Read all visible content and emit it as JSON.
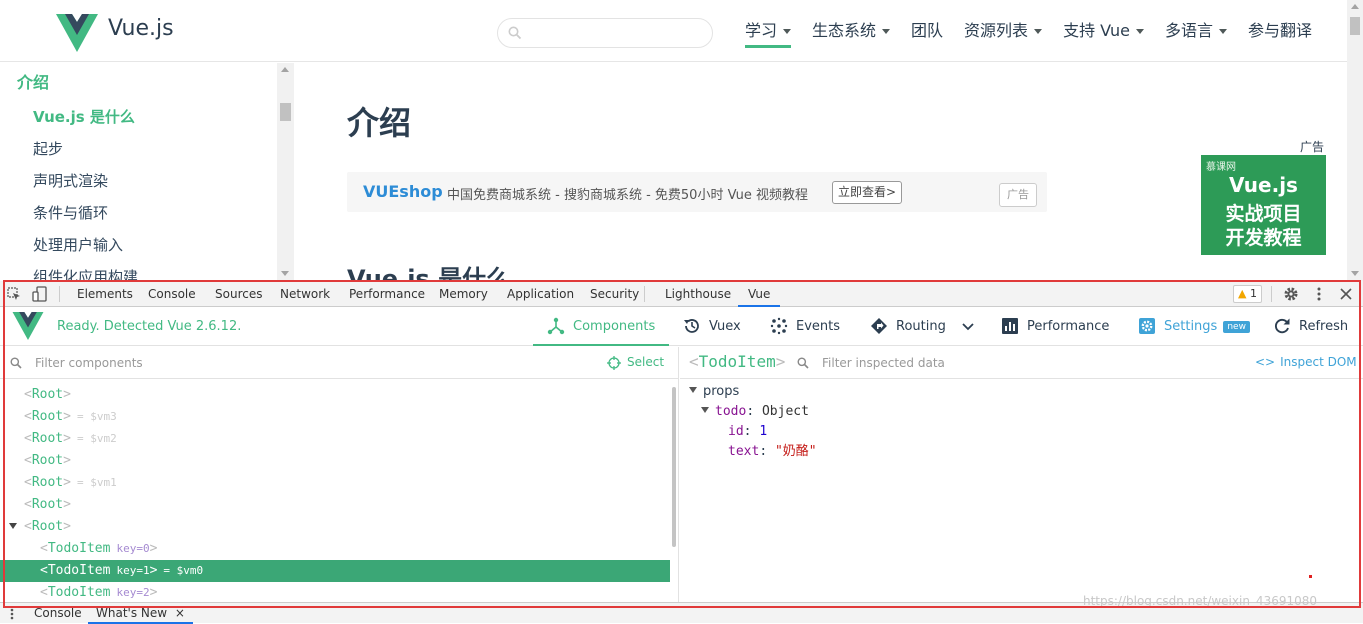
{
  "site": {
    "brand": "Vue.js",
    "nav": [
      {
        "label": "学习",
        "dropdown": true,
        "active": true
      },
      {
        "label": "生态系统",
        "dropdown": true
      },
      {
        "label": "团队",
        "dropdown": false
      },
      {
        "label": "资源列表",
        "dropdown": true
      },
      {
        "label": "支持 Vue",
        "dropdown": true
      },
      {
        "label": "多语言",
        "dropdown": true
      },
      {
        "label": "参与翻译",
        "dropdown": false
      }
    ],
    "sidebar": {
      "title": "介绍",
      "items": [
        "Vue.js 是什么",
        "起步",
        "声明式渲染",
        "条件与循环",
        "处理用户输入",
        "组件化应用构建"
      ]
    },
    "content": {
      "title": "介绍",
      "ad": {
        "brand": "VUEshop",
        "text": "中国免费商城系统 - 搜豹商城系统 - 免费50小时 Vue 视频教程",
        "cta": "立即查看>",
        "tag": "广告"
      },
      "side_ad": {
        "label": "广告",
        "brandline": "慕课网",
        "line1": "Vue.js",
        "line2": "实战项目",
        "line3": "开发教程"
      },
      "h2": "Vue.js 是什么"
    }
  },
  "devtools": {
    "tabs": [
      "Elements",
      "Console",
      "Sources",
      "Network",
      "Performance",
      "Memory",
      "Application",
      "Security",
      "Lighthouse",
      "Vue"
    ],
    "active_tab": "Vue",
    "warnings": "1",
    "vue": {
      "status": "Ready. Detected Vue 2.6.12.",
      "tabs": {
        "components": "Components",
        "vuex": "Vuex",
        "events": "Events",
        "routing": "Routing",
        "performance": "Performance",
        "settings": "Settings",
        "settings_badge": "new",
        "refresh": "Refresh"
      },
      "filter_components_placeholder": "Filter components",
      "select_label": "Select",
      "inspected": {
        "name": "TodoItem",
        "filter_placeholder": "Filter inspected data",
        "inspect_dom": "Inspect DOM"
      },
      "tree": [
        {
          "tag": "Root",
          "vm": ""
        },
        {
          "tag": "Root",
          "vm": "= $vm3"
        },
        {
          "tag": "Root",
          "vm": "= $vm2"
        },
        {
          "tag": "Root",
          "vm": ""
        },
        {
          "tag": "Root",
          "vm": "= $vm1"
        },
        {
          "tag": "Root",
          "vm": ""
        },
        {
          "tag": "Root",
          "vm": "",
          "expanded": true
        },
        {
          "tag": "TodoItem",
          "key": "key=0",
          "vm": "",
          "child": true
        },
        {
          "tag": "TodoItem",
          "key": "key=1",
          "vm": "= $vm0",
          "child": true,
          "selected": true
        },
        {
          "tag": "TodoItem",
          "key": "key=2",
          "vm": "",
          "child": true
        }
      ],
      "props": {
        "section": "props",
        "todo_key": "todo",
        "todo_type": "Object",
        "id_key": "id",
        "id_value": "1",
        "text_key": "text",
        "text_value": "\"奶酪\""
      }
    },
    "drawer": [
      "Console",
      "What's New"
    ]
  },
  "watermark": "https://blog.csdn.net/weixin_43691080",
  "colors": {
    "vue_green": "#42b983",
    "selected_row": "#3ba776",
    "accent_blue": "#3fa3d7",
    "frame_red": "#e03a3a"
  }
}
